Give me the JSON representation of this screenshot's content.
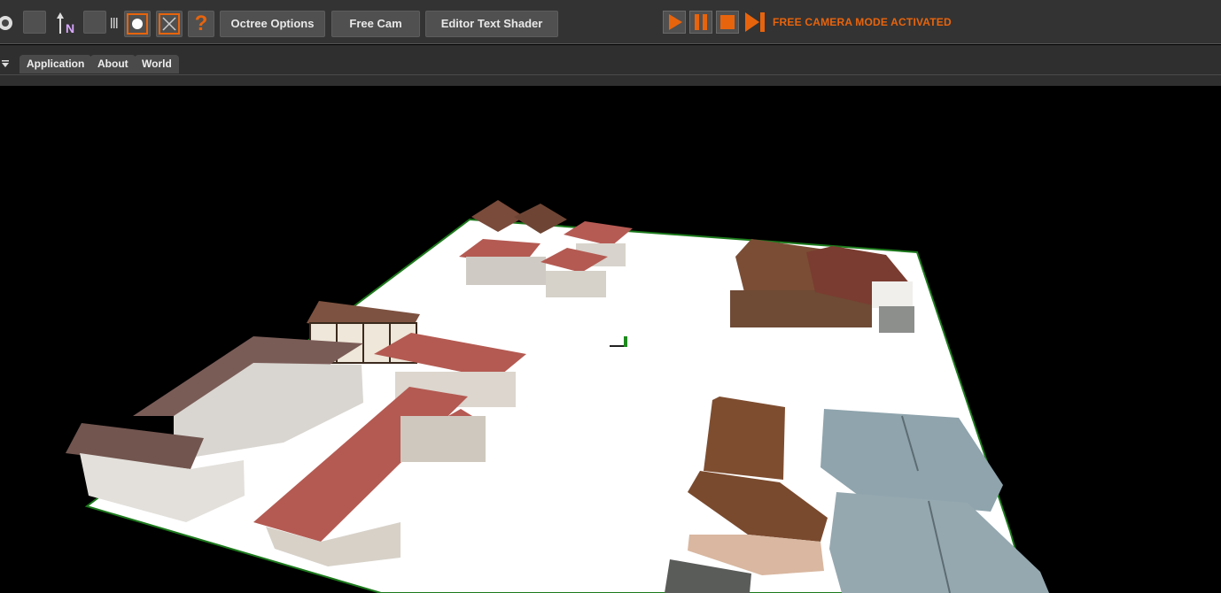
{
  "toolbar": {
    "buttons": {
      "octree": "Octree Options",
      "freecam": "Free Cam",
      "shader": "Editor Text Shader"
    },
    "icons": [
      "gear-icon",
      "blank-button",
      "north-arrow-icon",
      "blank-button",
      "grip-icon",
      "sphere-icon",
      "focus-selection-icon",
      "expand-view-icon",
      "help-icon"
    ],
    "playback": [
      "play-icon",
      "pause-icon",
      "stop-icon",
      "step-forward-icon"
    ],
    "status": "FREE CAMERA MODE ACTIVATED",
    "north_label": "N",
    "help_label": "?"
  },
  "tabs": [
    "Application",
    "About",
    "World"
  ],
  "colors": {
    "accent": "#e8640c",
    "toolbar_bg": "#333333",
    "ground": "#ffffff",
    "ground_edge": "#1c7a1c"
  },
  "viewport": {
    "description": "3D scene"
  }
}
